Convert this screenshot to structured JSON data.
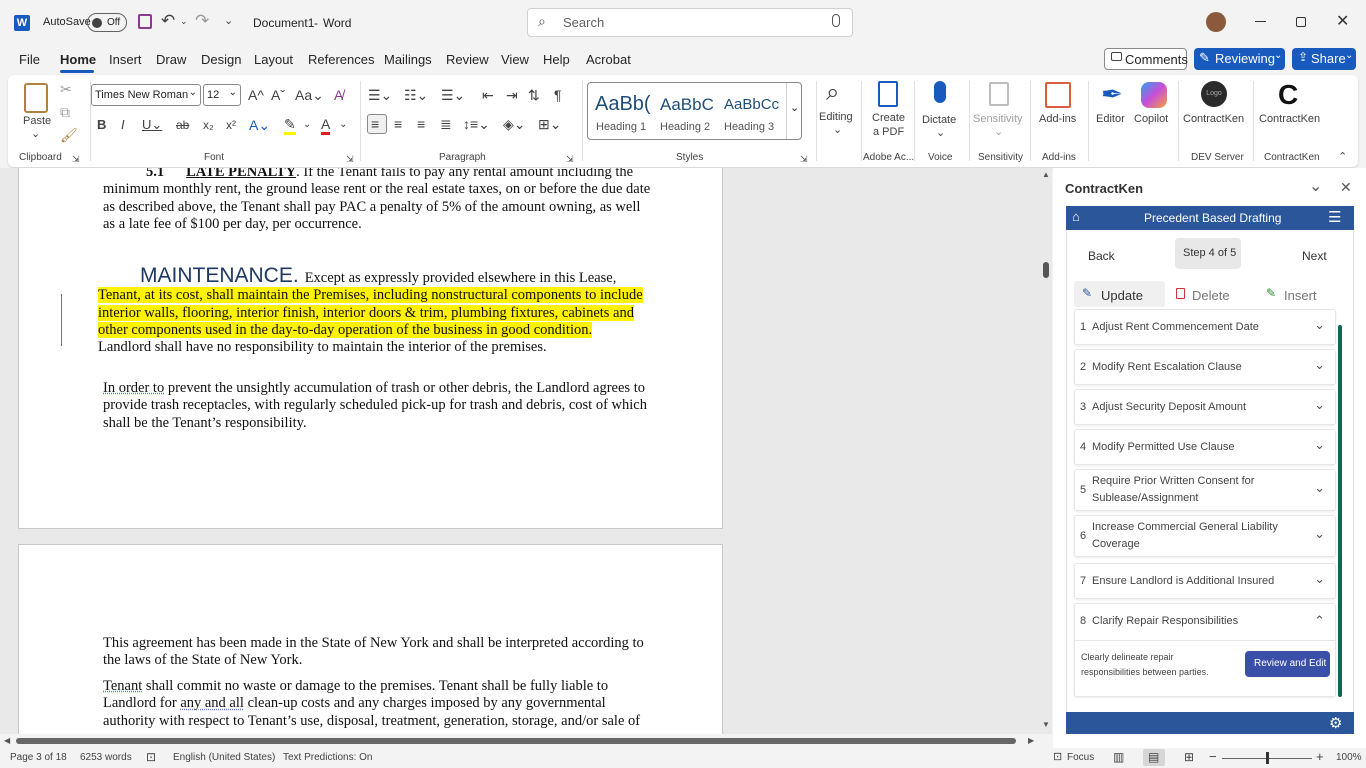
{
  "titlebar": {
    "app_icon": "word-icon",
    "autosave_label": "AutoSave",
    "autosave_state": "Off",
    "doc_title": "Document1",
    "app_name": "Word",
    "separator": "-",
    "search_placeholder": "Search"
  },
  "menu_tabs": [
    "File",
    "Home",
    "Insert",
    "Draw",
    "Design",
    "Layout",
    "References",
    "Mailings",
    "Review",
    "View",
    "Help",
    "Acrobat"
  ],
  "menu_right": {
    "comments": "Comments",
    "reviewing": "Reviewing",
    "share": "Share"
  },
  "ribbon": {
    "clipboard": {
      "paste": "Paste",
      "group": "Clipboard"
    },
    "font": {
      "name": "Times New Roman",
      "size": "12",
      "group": "Font"
    },
    "paragraph": {
      "group": "Paragraph"
    },
    "styles": {
      "items": [
        {
          "preview": "AaBb(",
          "label": "Heading 1"
        },
        {
          "preview": "AaBbC",
          "label": "Heading 2"
        },
        {
          "preview": "AaBbCc",
          "label": "Heading 3"
        }
      ],
      "group": "Styles"
    },
    "editing": "Editing",
    "adobe": {
      "label1": "Create",
      "label2": "a PDF",
      "group": "Adobe Ac..."
    },
    "voice": {
      "label": "Dictate",
      "group": "Voice"
    },
    "sensitivity": {
      "label": "Sensitivity",
      "group": "Sensitivity"
    },
    "addins": {
      "label": "Add-ins",
      "group": "Add-ins"
    },
    "editor": "Editor",
    "copilot": "Copilot",
    "contractken1": {
      "logo": "Logo",
      "label": "ContractKen",
      "group": "DEV Server"
    },
    "contractken2": {
      "logo": "C",
      "label": "ContractKen",
      "group": "ContractKen"
    }
  },
  "document": {
    "p1_num": "5.1",
    "p1_heading": "LATE PENALTY",
    "p1_text": ".   If the Tenant fails to pay any rental amount including the minimum monthly rent, the ground lease rent or the real estate taxes, on or before the due date as described above, the Tenant shall pay PAC a penalty of 5% of the amount owning, as well as a late fee of $100 per day, per occurrence.",
    "maint_heading": "MAINTENANCE.",
    "maint_first": "Except as expressly provided elsewhere in this Lease,",
    "maint_highlight": "Tenant, at its cost, shall maintain the Premises, including nonstructural components to include interior walls, flooring, interior finish, interior doors & trim, plumbing fixtures, cabinets and other components used in the day-to-day operation of the business in good condition.",
    "maint_rest": " Landlord shall have no responsibility to maintain the interior of the premises.",
    "trash_underlined": "In order to",
    "trash_text": " prevent the unsightly accumulation of trash or other debris, the Landlord agrees to provide trash receptacles, with regularly scheduled pick-up for trash and debris, cost of which shall be the Tenant’s responsibility.",
    "page2_p1": "This agreement has been made in the State of New York and shall be interpreted according to the laws of the State of New York.",
    "page2_p2_tenant": "Tenant",
    "page2_p2_a": " shall commit no waste or damage to the premises.  Tenant shall be fully liable to Landlord for ",
    "page2_p2_anyall": "any and all",
    "page2_p2_b": " clean-up costs and any charges imposed by any governmental authority with respect to Tenant’s use, disposal, treatment, generation, storage, and/or sale of"
  },
  "status": {
    "page": "Page 3 of 18",
    "words": "6253 words",
    "language": "English (United States)",
    "predictions": "Text Predictions: On",
    "focus": "Focus",
    "zoom": "100%"
  },
  "pane": {
    "title": "ContractKen",
    "banner": "Precedent Based Drafting",
    "back": "Back",
    "step": "Step 4 of 5",
    "next": "Next",
    "tabs": {
      "update": "Update",
      "delete": "Delete",
      "insert": "Insert"
    },
    "items": [
      {
        "n": "1",
        "label": "Adjust Rent Commencement Date"
      },
      {
        "n": "2",
        "label": "Modify Rent Escalation Clause"
      },
      {
        "n": "3",
        "label": "Adjust Security Deposit Amount"
      },
      {
        "n": "4",
        "label": "Modify Permitted Use Clause"
      },
      {
        "n": "5",
        "label": "Require Prior Written Consent for Sublease/Assignment"
      },
      {
        "n": "6",
        "label": "Increase Commercial General Liability Coverage"
      },
      {
        "n": "7",
        "label": "Ensure Landlord is Additional Insured"
      },
      {
        "n": "8",
        "label": "Clarify Repair Responsibilities"
      }
    ],
    "item8_desc": "Clearly delineate repair responsibilities between parties.",
    "review_button": "Review and Edit"
  },
  "colors": {
    "word_blue": "#185abd",
    "highlight": "#fff200",
    "pane_blue": "#2b579a",
    "pane_button": "#3a4fa8",
    "teal_scroll": "#0e6655"
  }
}
